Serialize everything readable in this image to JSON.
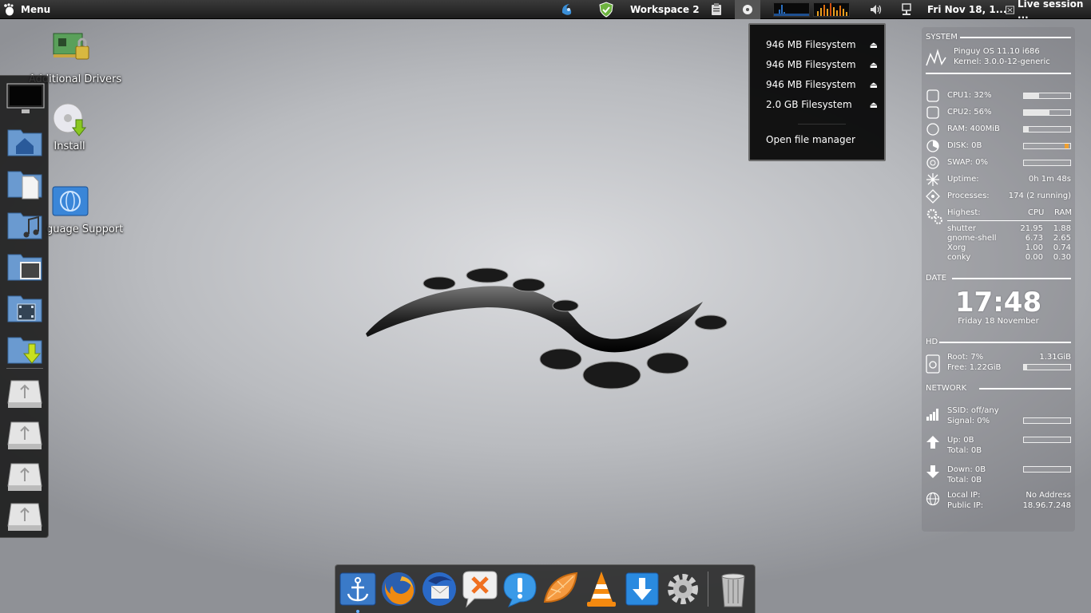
{
  "top_panel": {
    "menu_label": "Menu",
    "workspace": "Workspace 2",
    "datetime": "Fri Nov 18, 1...",
    "session": "Live session ..."
  },
  "desktop_icons": [
    {
      "label": "Additional Drivers",
      "icon": "drivers-card-icon"
    },
    {
      "label": "Install",
      "icon": "install-disc-icon"
    },
    {
      "label": "guage Support",
      "icon": "language-globe-icon"
    }
  ],
  "mount_menu": {
    "items": [
      {
        "label": "946 MB Filesystem"
      },
      {
        "label": "946 MB Filesystem"
      },
      {
        "label": "946 MB Filesystem"
      },
      {
        "label": "2.0 GB Filesystem"
      }
    ],
    "open_file_manager": "Open file manager"
  },
  "conky": {
    "system_header": "SYSTEM",
    "os": "Pinguy OS 11.10 i686",
    "kernel": "Kernel: 3.0.0-12-generic",
    "cpu1": {
      "label": "CPU1: 32%",
      "fraction": 0.32
    },
    "cpu2": {
      "label": "CPU2: 56%",
      "fraction": 0.56
    },
    "ram": {
      "label": "RAM: 400MiB",
      "fraction": 0.1
    },
    "disk": {
      "label": "DISK: 0B",
      "fraction": 0.0
    },
    "swap": {
      "label": "SWAP: 0%",
      "fraction": 0.0
    },
    "uptime_label": "Uptime:",
    "uptime_value": "0h 1m 48s",
    "processes_label": "Processes:",
    "processes_value": "174 (2 running)",
    "highest_label": "Highest:",
    "cpu_col": "CPU",
    "ram_col": "RAM",
    "top_procs": [
      {
        "name": "shutter",
        "cpu": "21.95",
        "ram": "1.88"
      },
      {
        "name": "gnome-shell",
        "cpu": "6.73",
        "ram": "2.65"
      },
      {
        "name": "Xorg",
        "cpu": "1.00",
        "ram": "0.74"
      },
      {
        "name": "conky",
        "cpu": "0.00",
        "ram": "0.30"
      }
    ],
    "date_header": "DATE",
    "time": "17:48",
    "date": "Friday 18 November",
    "hd_header": "HD",
    "root": "Root: 7%",
    "root_size": "1.31GiB",
    "free": "Free: 1.22GiB",
    "root_fraction": 0.07,
    "network_header": "NETWORK",
    "ssid": "SSID: off/any",
    "signal": "Signal: 0%",
    "up": "Up: 0B",
    "up_total": "Total: 0B",
    "down": "Down: 0B",
    "down_total": "Total: 0B",
    "local_ip_label": "Local IP:",
    "local_ip": "No Address",
    "public_ip_label": "Public IP:",
    "public_ip": "18.96.7.248"
  },
  "colors": {
    "accent": "#f0a030",
    "panel": "#1c1c1c"
  }
}
